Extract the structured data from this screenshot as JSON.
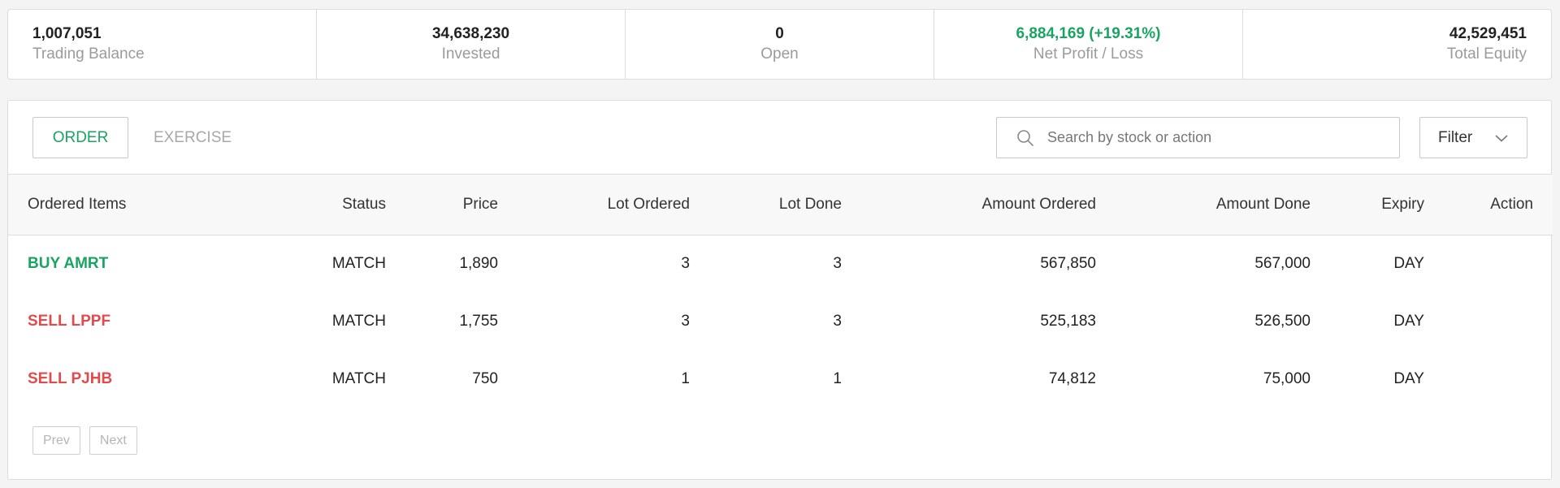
{
  "summary": [
    {
      "value": "1,007,051",
      "label": "Trading Balance"
    },
    {
      "value": "34,638,230",
      "label": "Invested"
    },
    {
      "value": "0",
      "label": "Open"
    },
    {
      "value": "6,884,169 (+19.31%)",
      "label": "Net Profit / Loss"
    },
    {
      "value": "42,529,451",
      "label": "Total Equity"
    }
  ],
  "colors": {
    "accent_green": "#1aa462",
    "sell_red": "#e14b4b"
  },
  "tabs": {
    "order": "ORDER",
    "exercise": "EXERCISE"
  },
  "search": {
    "placeholder": "Search by stock or action",
    "icon": "search-icon"
  },
  "filter": {
    "label": "Filter",
    "icon": "chevron-down-icon"
  },
  "table": {
    "headers": [
      "Ordered Items",
      "Status",
      "Price",
      "Lot Ordered",
      "Lot Done",
      "Amount Ordered",
      "Amount Done",
      "Expiry",
      "Action"
    ],
    "rows": [
      {
        "item": "BUY AMRT",
        "side": "buy",
        "status": "MATCH",
        "price": "1,890",
        "lot_ordered": "3",
        "lot_done": "3",
        "amount_ordered": "567,850",
        "amount_done": "567,000",
        "expiry": "DAY",
        "action": ""
      },
      {
        "item": "SELL LPPF",
        "side": "sell",
        "status": "MATCH",
        "price": "1,755",
        "lot_ordered": "3",
        "lot_done": "3",
        "amount_ordered": "525,183",
        "amount_done": "526,500",
        "expiry": "DAY",
        "action": ""
      },
      {
        "item": "SELL PJHB",
        "side": "sell",
        "status": "MATCH",
        "price": "750",
        "lot_ordered": "1",
        "lot_done": "1",
        "amount_ordered": "74,812",
        "amount_done": "75,000",
        "expiry": "DAY",
        "action": ""
      }
    ]
  },
  "pager": {
    "prev": "Prev",
    "next": "Next"
  }
}
